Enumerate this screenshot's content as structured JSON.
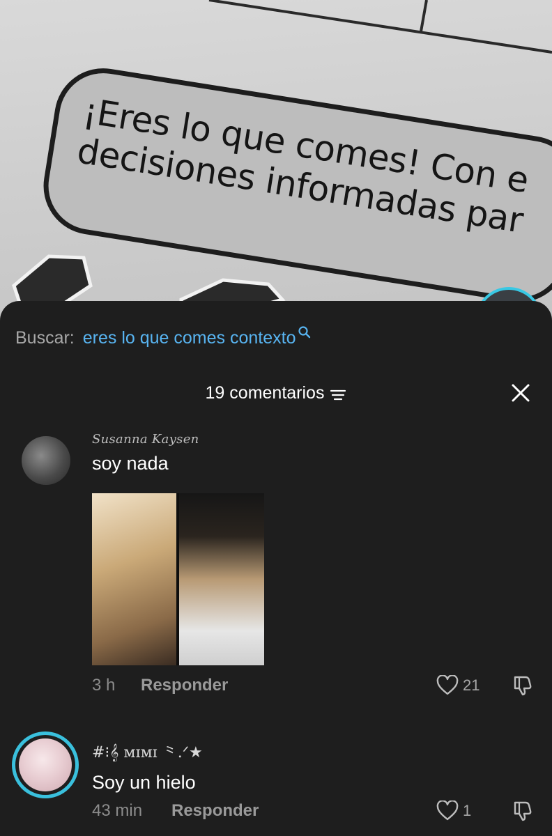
{
  "video": {
    "caption_lines": [
      "¡Eres lo que comes! Con e",
      "decisiones informadas par"
    ]
  },
  "search": {
    "label": "Buscar:",
    "query": "eres lo que comes contexto"
  },
  "header": {
    "comment_count": "19 comentarios"
  },
  "comments": [
    {
      "username": "Susanna Kaysen",
      "text": "soy nada",
      "time": "3 h",
      "reply_label": "Responder",
      "likes": "21",
      "has_image": true
    },
    {
      "username": "#⁝𝄞 ᴍɪᴍɪ ⺀.ᐟ★",
      "text": "Soy un hielo",
      "time": "43 min",
      "reply_label": "Responder",
      "likes": "1",
      "has_image": false
    }
  ],
  "colors": {
    "sheet_background": "#1e1e1e",
    "link_blue": "#58b4f1",
    "avatar_ring": "#3ac0dd"
  },
  "icons": [
    "search-icon",
    "sort-icon",
    "close-icon",
    "heart-icon",
    "dislike-icon"
  ]
}
